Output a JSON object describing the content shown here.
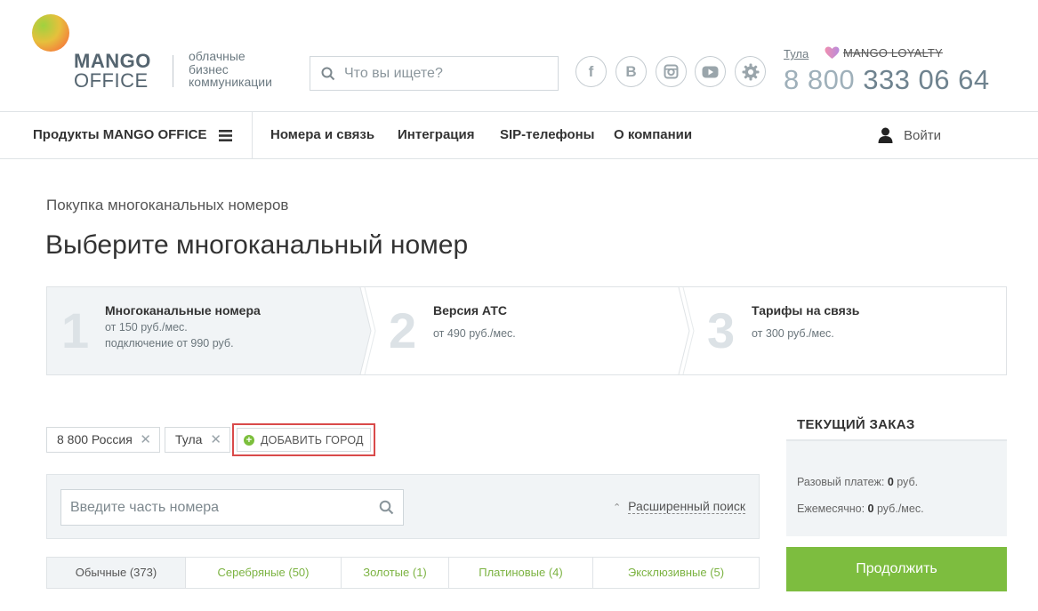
{
  "header": {
    "logo_line1": "MANGO",
    "logo_line2": "OFFICE",
    "tagline": [
      "облачные",
      "бизнес",
      "коммуникации"
    ],
    "search_placeholder": "Что вы ищете?",
    "social": [
      {
        "icon": "facebook-icon",
        "glyph": "f"
      },
      {
        "icon": "vkontakte-icon",
        "glyph": "B"
      },
      {
        "icon": "instagram-icon",
        "glyph": ""
      },
      {
        "icon": "youtube-icon",
        "glyph": ""
      },
      {
        "icon": "settings-icon",
        "glyph": ""
      }
    ],
    "city": "Тула",
    "loyalty": "MANGO LOYALTY",
    "phone_prefix": "8 800",
    "phone_number": "333 06 64"
  },
  "nav": {
    "products": "Продукты MANGO OFFICE",
    "links": [
      "Номера и связь",
      "Интеграция",
      "SIP-телефоны",
      "О компании"
    ],
    "login": "Войти"
  },
  "page": {
    "breadcrumb": "Покупка многоканальных номеров",
    "title": "Выберите многоканальный номер"
  },
  "steps": [
    {
      "num": "1",
      "title": "Многоканальные номера",
      "sub1": "от 150 руб./мес.",
      "sub2": "подключение от 990 руб."
    },
    {
      "num": "2",
      "title": "Версия АТС",
      "sub1": "от 490 руб./мес.",
      "sub2": ""
    },
    {
      "num": "3",
      "title": "Тарифы на связь",
      "sub1": "от 300 руб./мес.",
      "sub2": ""
    }
  ],
  "filters": {
    "tags": [
      "8 800 Россия",
      "Тула"
    ],
    "add_city": "ДОБАВИТЬ ГОРОД",
    "number_placeholder": "Введите часть номера",
    "advanced_search": "Расширенный поиск"
  },
  "tabs": [
    "Обычные (373)",
    "Серебряные (50)",
    "Золотые (1)",
    "Платиновые (4)",
    "Эксклюзивные (5)"
  ],
  "order": {
    "title": "ТЕКУЩИЙ ЗАКАЗ",
    "one_time_label": "Разовый платеж:",
    "one_time_value": "0",
    "one_time_unit": "руб.",
    "monthly_label": "Ежемесячно:",
    "monthly_value": "0",
    "monthly_unit": "руб./мес.",
    "continue": "Продолжить"
  },
  "colors": {
    "accent_green": "#7dbd3f",
    "highlight_red": "#d94a4a"
  }
}
